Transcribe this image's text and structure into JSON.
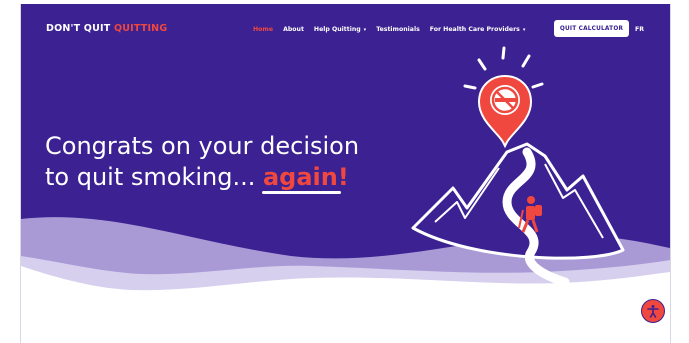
{
  "header": {
    "logo_part1": "DON'T QUIT",
    "logo_part2": "QUITTING"
  },
  "nav": {
    "home": "Home",
    "about": "About",
    "help_quitting": "Help Quitting",
    "testimonials": "Testimonials",
    "health_care_providers": "For Health Care Providers",
    "quit_calculator": "QUIT CALCULATOR",
    "language": "FR"
  },
  "hero": {
    "line1": "Congrats on your decision",
    "line2_prefix": "to quit smoking...",
    "line2_accent": "again!"
  },
  "icons": {
    "no_smoking": "no-smoking-icon",
    "accessibility": "accessibility-icon",
    "chevron": "chevron-down-icon"
  },
  "colors": {
    "brand_purple": "#3b2192",
    "accent_coral": "#f0473f",
    "wave_lavender": "#a99ad6",
    "white": "#ffffff"
  }
}
